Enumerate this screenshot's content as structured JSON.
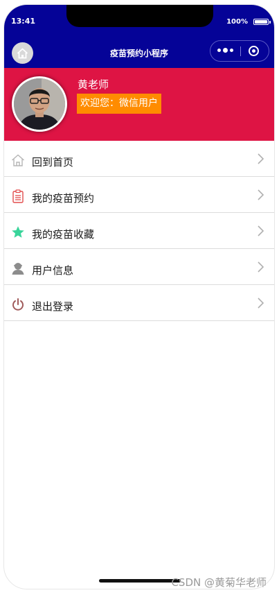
{
  "status_bar": {
    "time": "13:41",
    "battery": "100%"
  },
  "nav_bar": {
    "title": "疫苗预约小程序"
  },
  "profile": {
    "name": "黄老师",
    "welcome": "欢迎您：微信用户"
  },
  "menu": {
    "items": [
      {
        "label": "回到首页",
        "icon": "home-icon",
        "icon_color": "#b5b5b5"
      },
      {
        "label": "我的疫苗预约",
        "icon": "clipboard-icon",
        "icon_color": "#e24c4c"
      },
      {
        "label": "我的疫苗收藏",
        "icon": "star-icon",
        "icon_color": "#39d49a"
      },
      {
        "label": "用户信息",
        "icon": "user-icon",
        "icon_color": "#8c8c8c"
      },
      {
        "label": "退出登录",
        "icon": "power-icon",
        "icon_color": "#a05a5a"
      }
    ]
  },
  "watermark": "CSDN @黄菊华老师",
  "colors": {
    "nav_background": "#050397",
    "profile_background": "#de1444",
    "welcome_background": "#ff8c00"
  }
}
